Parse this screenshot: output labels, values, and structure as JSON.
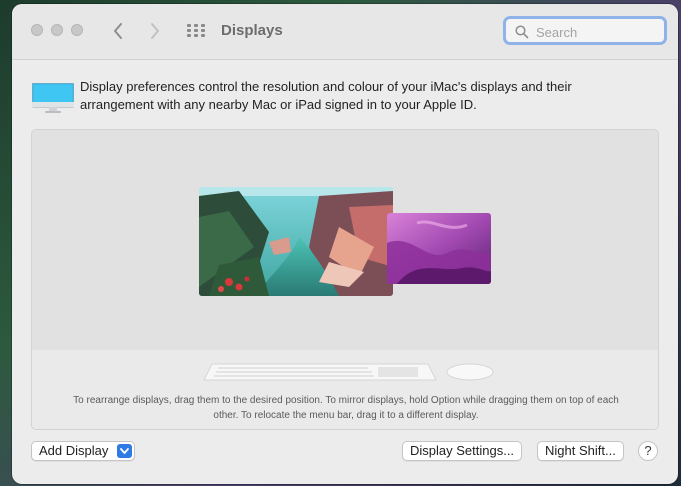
{
  "window": {
    "title": "Displays"
  },
  "search": {
    "placeholder": "Search"
  },
  "description": "Display preferences control the resolution and colour of your iMac's displays and their arrangement with any nearby Mac or iPad signed in to your Apple ID.",
  "arrangement_hint": "To rearrange displays, drag them to the desired position. To mirror displays, hold Option while dragging them on top of each other. To relocate the menu bar, drag it to a different display.",
  "footer": {
    "add_display": "Add Display",
    "display_settings": "Display Settings...",
    "night_shift": "Night Shift...",
    "help": "?"
  },
  "icons": [
    "close-button",
    "minimize-button",
    "zoom-button",
    "back-icon",
    "forward-icon",
    "show-all-grid-icon",
    "search-icon",
    "imac-display-icon",
    "chevron-down-icon"
  ],
  "colors": {
    "accent": "#2f7ae5",
    "search_focus_ring": "#8fb3e8"
  }
}
